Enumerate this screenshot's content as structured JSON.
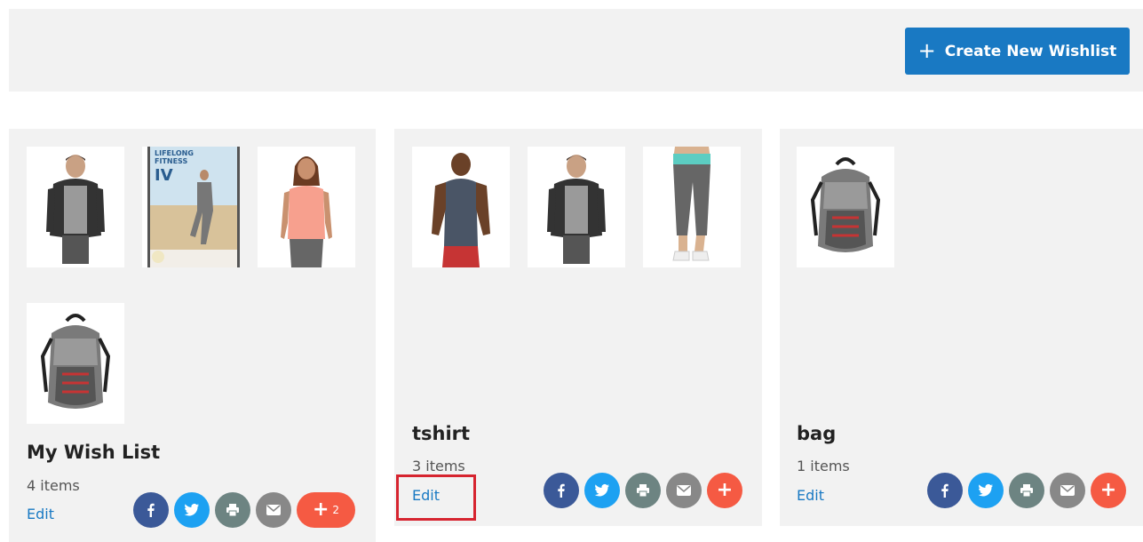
{
  "toolbar": {
    "create_label": "Create New Wishlist",
    "create_icon": "plus-icon"
  },
  "colors": {
    "primary": "#1979c3",
    "facebook": "#3b5998",
    "twitter": "#1da1f2",
    "print": "#6d8482",
    "email": "#888888",
    "more": "#f55a43",
    "highlight": "#d6242f"
  },
  "wishlists": [
    {
      "name": "My Wish List",
      "count": "4 items",
      "edit_label": "Edit",
      "products": [
        "hoodie-man",
        "fitness-dvd",
        "pink-tee-woman",
        "backpack"
      ],
      "share_more": "2"
    },
    {
      "name": "tshirt",
      "count": "3 items",
      "edit_label": "Edit",
      "products": [
        "tank-top-man",
        "hoodie-man",
        "capri-leggings"
      ]
    },
    {
      "name": "bag",
      "count": "1 items",
      "edit_label": "Edit",
      "products": [
        "backpack"
      ]
    }
  ],
  "share_icons": [
    "facebook-icon",
    "twitter-icon",
    "print-icon",
    "email-icon",
    "plus-icon"
  ]
}
